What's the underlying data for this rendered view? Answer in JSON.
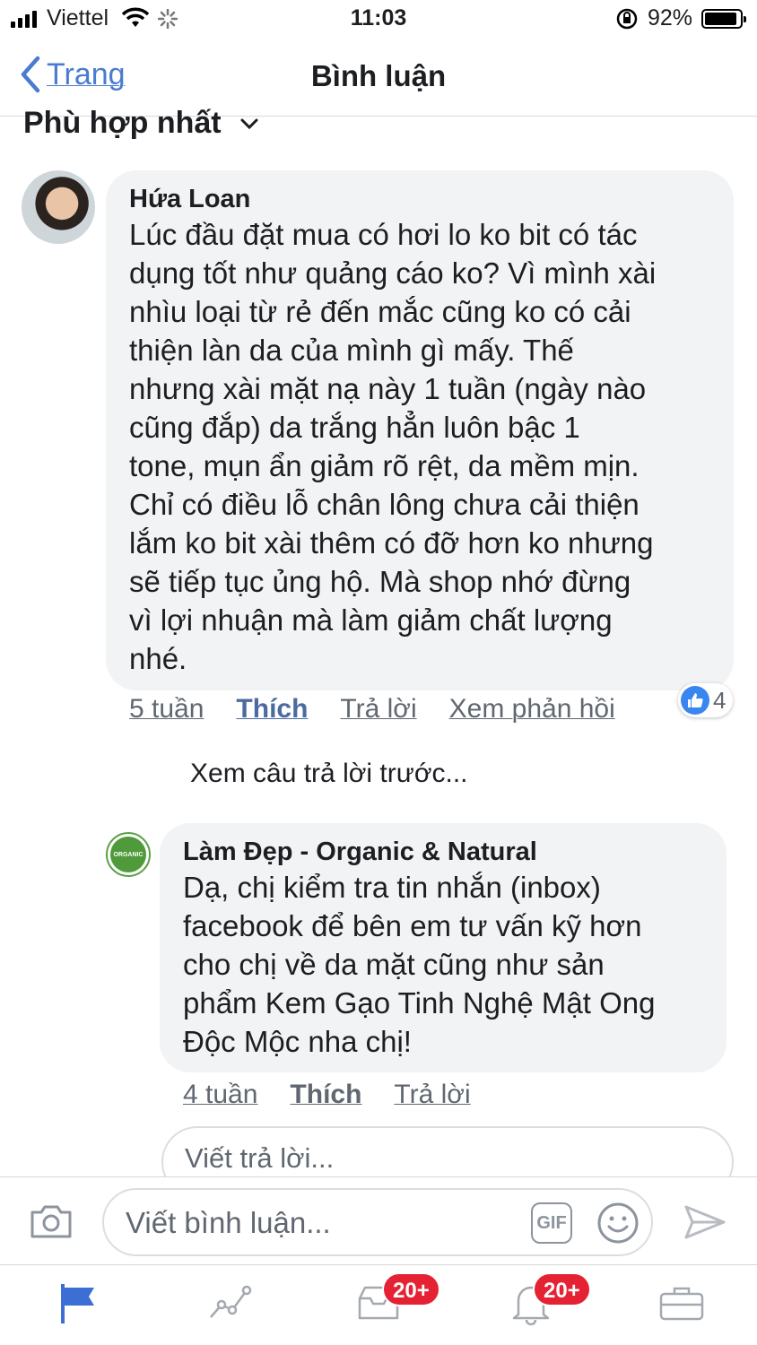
{
  "status_bar": {
    "carrier": "Viettel",
    "time": "11:03",
    "battery": "92%",
    "battery_level": 0.92
  },
  "nav": {
    "back_label": "Trang",
    "title": "Bình luận"
  },
  "sort": {
    "label": "Phù hợp nhất"
  },
  "comments": [
    {
      "author": "Hứa Loan",
      "text": "Lúc đầu đặt mua có hơi lo ko bit có tác\ndụng tốt như quảng cáo ko? Vì mình xài\nnhìu loại từ rẻ đến mắc cũng ko có cải\nthiện làn da của mình gì mấy. Thế\nnhưng xài mặt nạ này 1 tuần (ngày nào\ncũng đắp) da trắng hẳn luôn bậc 1\ntone, mụn ẩn giảm rõ rệt, da mềm mịn.\nChỉ có điều lỗ chân lông chưa cải thiện\nlắm ko bit xài thêm có đỡ hơn ko nhưng\nsẽ tiếp tục ủng hộ. Mà shop nhớ đừng\nvì lợi nhuận mà làm giảm chất lượng\nnhé.",
      "time": "5 tuần",
      "like": "Thích",
      "reply": "Trả lời",
      "view_replies": "Xem phản hồi",
      "reaction_count": "4"
    }
  ],
  "prev_replies": "Xem câu trả lời trước...",
  "reply": {
    "author": "Làm Đẹp - Organic & Natural",
    "avatar_text": "ORGANIC",
    "text": "Dạ, chị kiểm tra tin nhắn (inbox)\nfacebook để bên em tư vấn kỹ hơn\ncho chị về da mặt cũng như sản\nphẩm Kem Gạo Tinh Nghệ Mật Ong\nĐộc Mộc nha chị!",
    "time": "4 tuần",
    "like": "Thích",
    "reply": "Trả lời"
  },
  "reply_box": {
    "placeholder": "Viết trả lời..."
  },
  "comment_bar": {
    "placeholder": "Viết bình luận...",
    "gif_label": "GIF"
  },
  "tab_bar": {
    "badges": [
      "20+",
      "20+"
    ]
  },
  "colors": {
    "link_blue": "#4a7bd0",
    "bubble": "#f2f3f5",
    "badge_red": "#e52233",
    "like_blue": "#3a86f0"
  }
}
